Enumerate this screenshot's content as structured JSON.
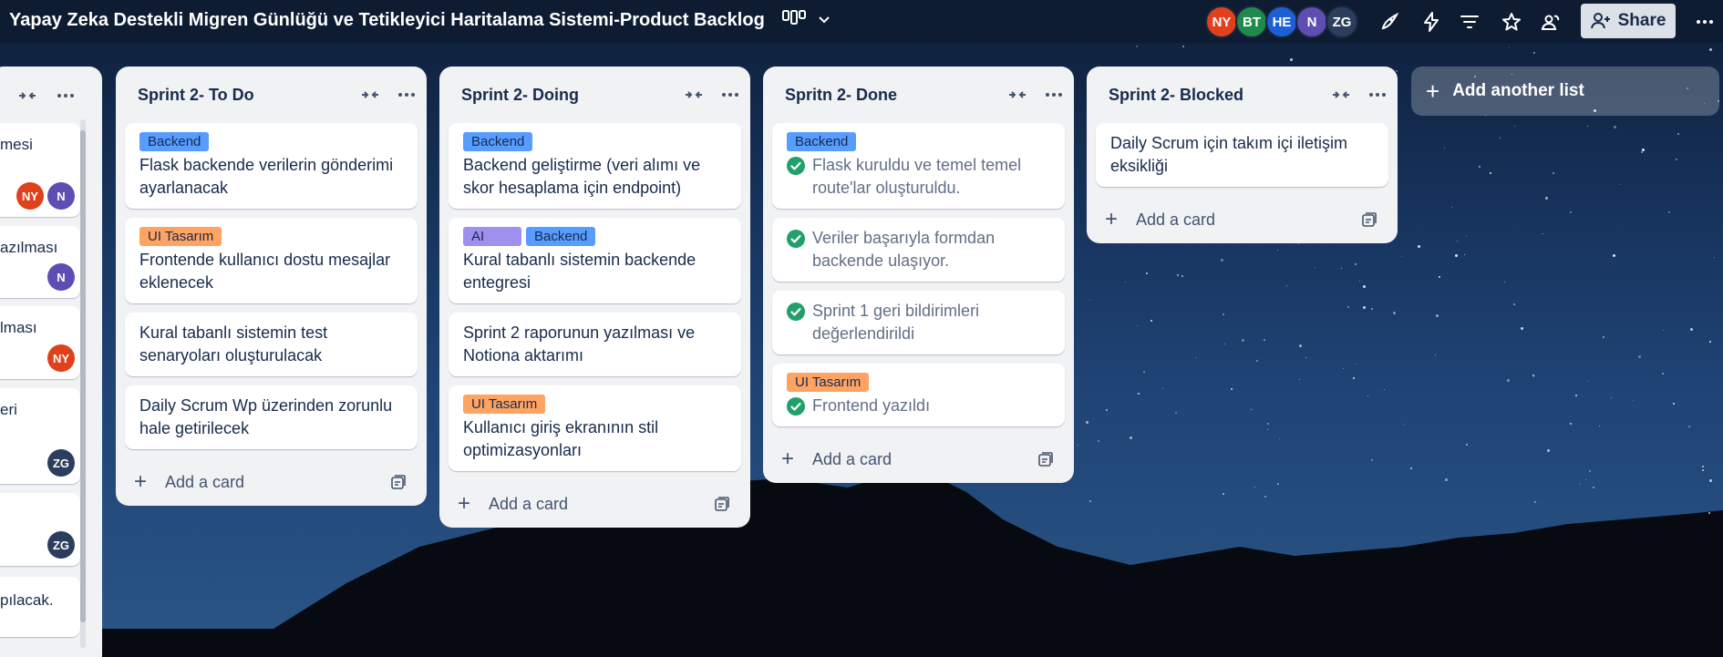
{
  "board": {
    "title": "Yapay Zeka Destekli Migren Günlüğü ve Tetikleyici Haritalama Sistemi-Product Backlog",
    "share_label": "Share",
    "members": [
      {
        "initials": "NY",
        "color": "#e0401c"
      },
      {
        "initials": "BT",
        "color": "#1f8a4c"
      },
      {
        "initials": "HE",
        "color": "#1d5fd6"
      },
      {
        "initials": "N",
        "color": "#5e4db2"
      },
      {
        "initials": "ZG",
        "color": "#2c3e5d"
      }
    ]
  },
  "colors": {
    "label_backend": "#579dff",
    "label_ui": "#fea362",
    "label_ai": "#9f8fef",
    "check_green": "#22a06b"
  },
  "partial_list": {
    "fragments": [
      "mesi",
      "azılması",
      "lması",
      "eri",
      "",
      "pılacak."
    ],
    "avatars": [
      [
        "NY",
        "N"
      ],
      [
        "N"
      ],
      [
        "NY"
      ],
      [
        "ZG"
      ],
      [
        "ZG"
      ]
    ]
  },
  "lists": [
    {
      "title": "Sprint 2- To Do",
      "add_label": "Add a card",
      "cards": [
        {
          "labels": [
            {
              "text": "Backend",
              "kind": "backend"
            }
          ],
          "text": "Flask backende verilerin gönderimi ayarlanacak"
        },
        {
          "labels": [
            {
              "text": "UI Tasarım",
              "kind": "ui"
            }
          ],
          "text": "Frontende kullanıcı dostu mesajlar eklenecek"
        },
        {
          "labels": [],
          "text": "Kural tabanlı sistemin test senaryoları oluşturulacak"
        },
        {
          "labels": [],
          "text": "Daily Scrum Wp üzerinden zorunlu hale getirilecek"
        }
      ]
    },
    {
      "title": "Sprint 2- Doing",
      "add_label": "Add a card",
      "cards": [
        {
          "labels": [
            {
              "text": "Backend",
              "kind": "backend"
            }
          ],
          "text": "Backend geliştirme (veri alımı ve skor hesaplama için endpoint)"
        },
        {
          "labels": [
            {
              "text": "AI",
              "kind": "ai"
            },
            {
              "text": "Backend",
              "kind": "backend"
            }
          ],
          "text": "Kural tabanlı sistemin backende entegresi"
        },
        {
          "labels": [],
          "text": "Sprint 2 raporunun yazılması ve Notiona aktarımı"
        },
        {
          "labels": [
            {
              "text": "UI Tasarım",
              "kind": "ui"
            }
          ],
          "text": "Kullanıcı giriş ekranının stil optimizasyonları"
        }
      ]
    },
    {
      "title": "Spritn 2- Done",
      "add_label": "Add a card",
      "cards": [
        {
          "labels": [
            {
              "text": "Backend",
              "kind": "backend"
            }
          ],
          "text": "Flask kuruldu ve temel temel route'lar oluşturuldu.",
          "done": true
        },
        {
          "labels": [],
          "text": "Veriler başarıyla formdan backende ulaşıyor.",
          "done": true
        },
        {
          "labels": [],
          "text": "Sprint 1 geri bildirimleri değerlendirildi",
          "done": true
        },
        {
          "labels": [
            {
              "text": "UI Tasarım",
              "kind": "ui"
            }
          ],
          "text": "Frontend yazıldı",
          "done": true
        }
      ]
    },
    {
      "title": "Sprint 2- Blocked",
      "add_label": "Add a card",
      "cards": [
        {
          "labels": [],
          "text": "Daily Scrum için takım içi iletişim eksikliği"
        }
      ]
    }
  ],
  "add_list_label": "Add another list"
}
